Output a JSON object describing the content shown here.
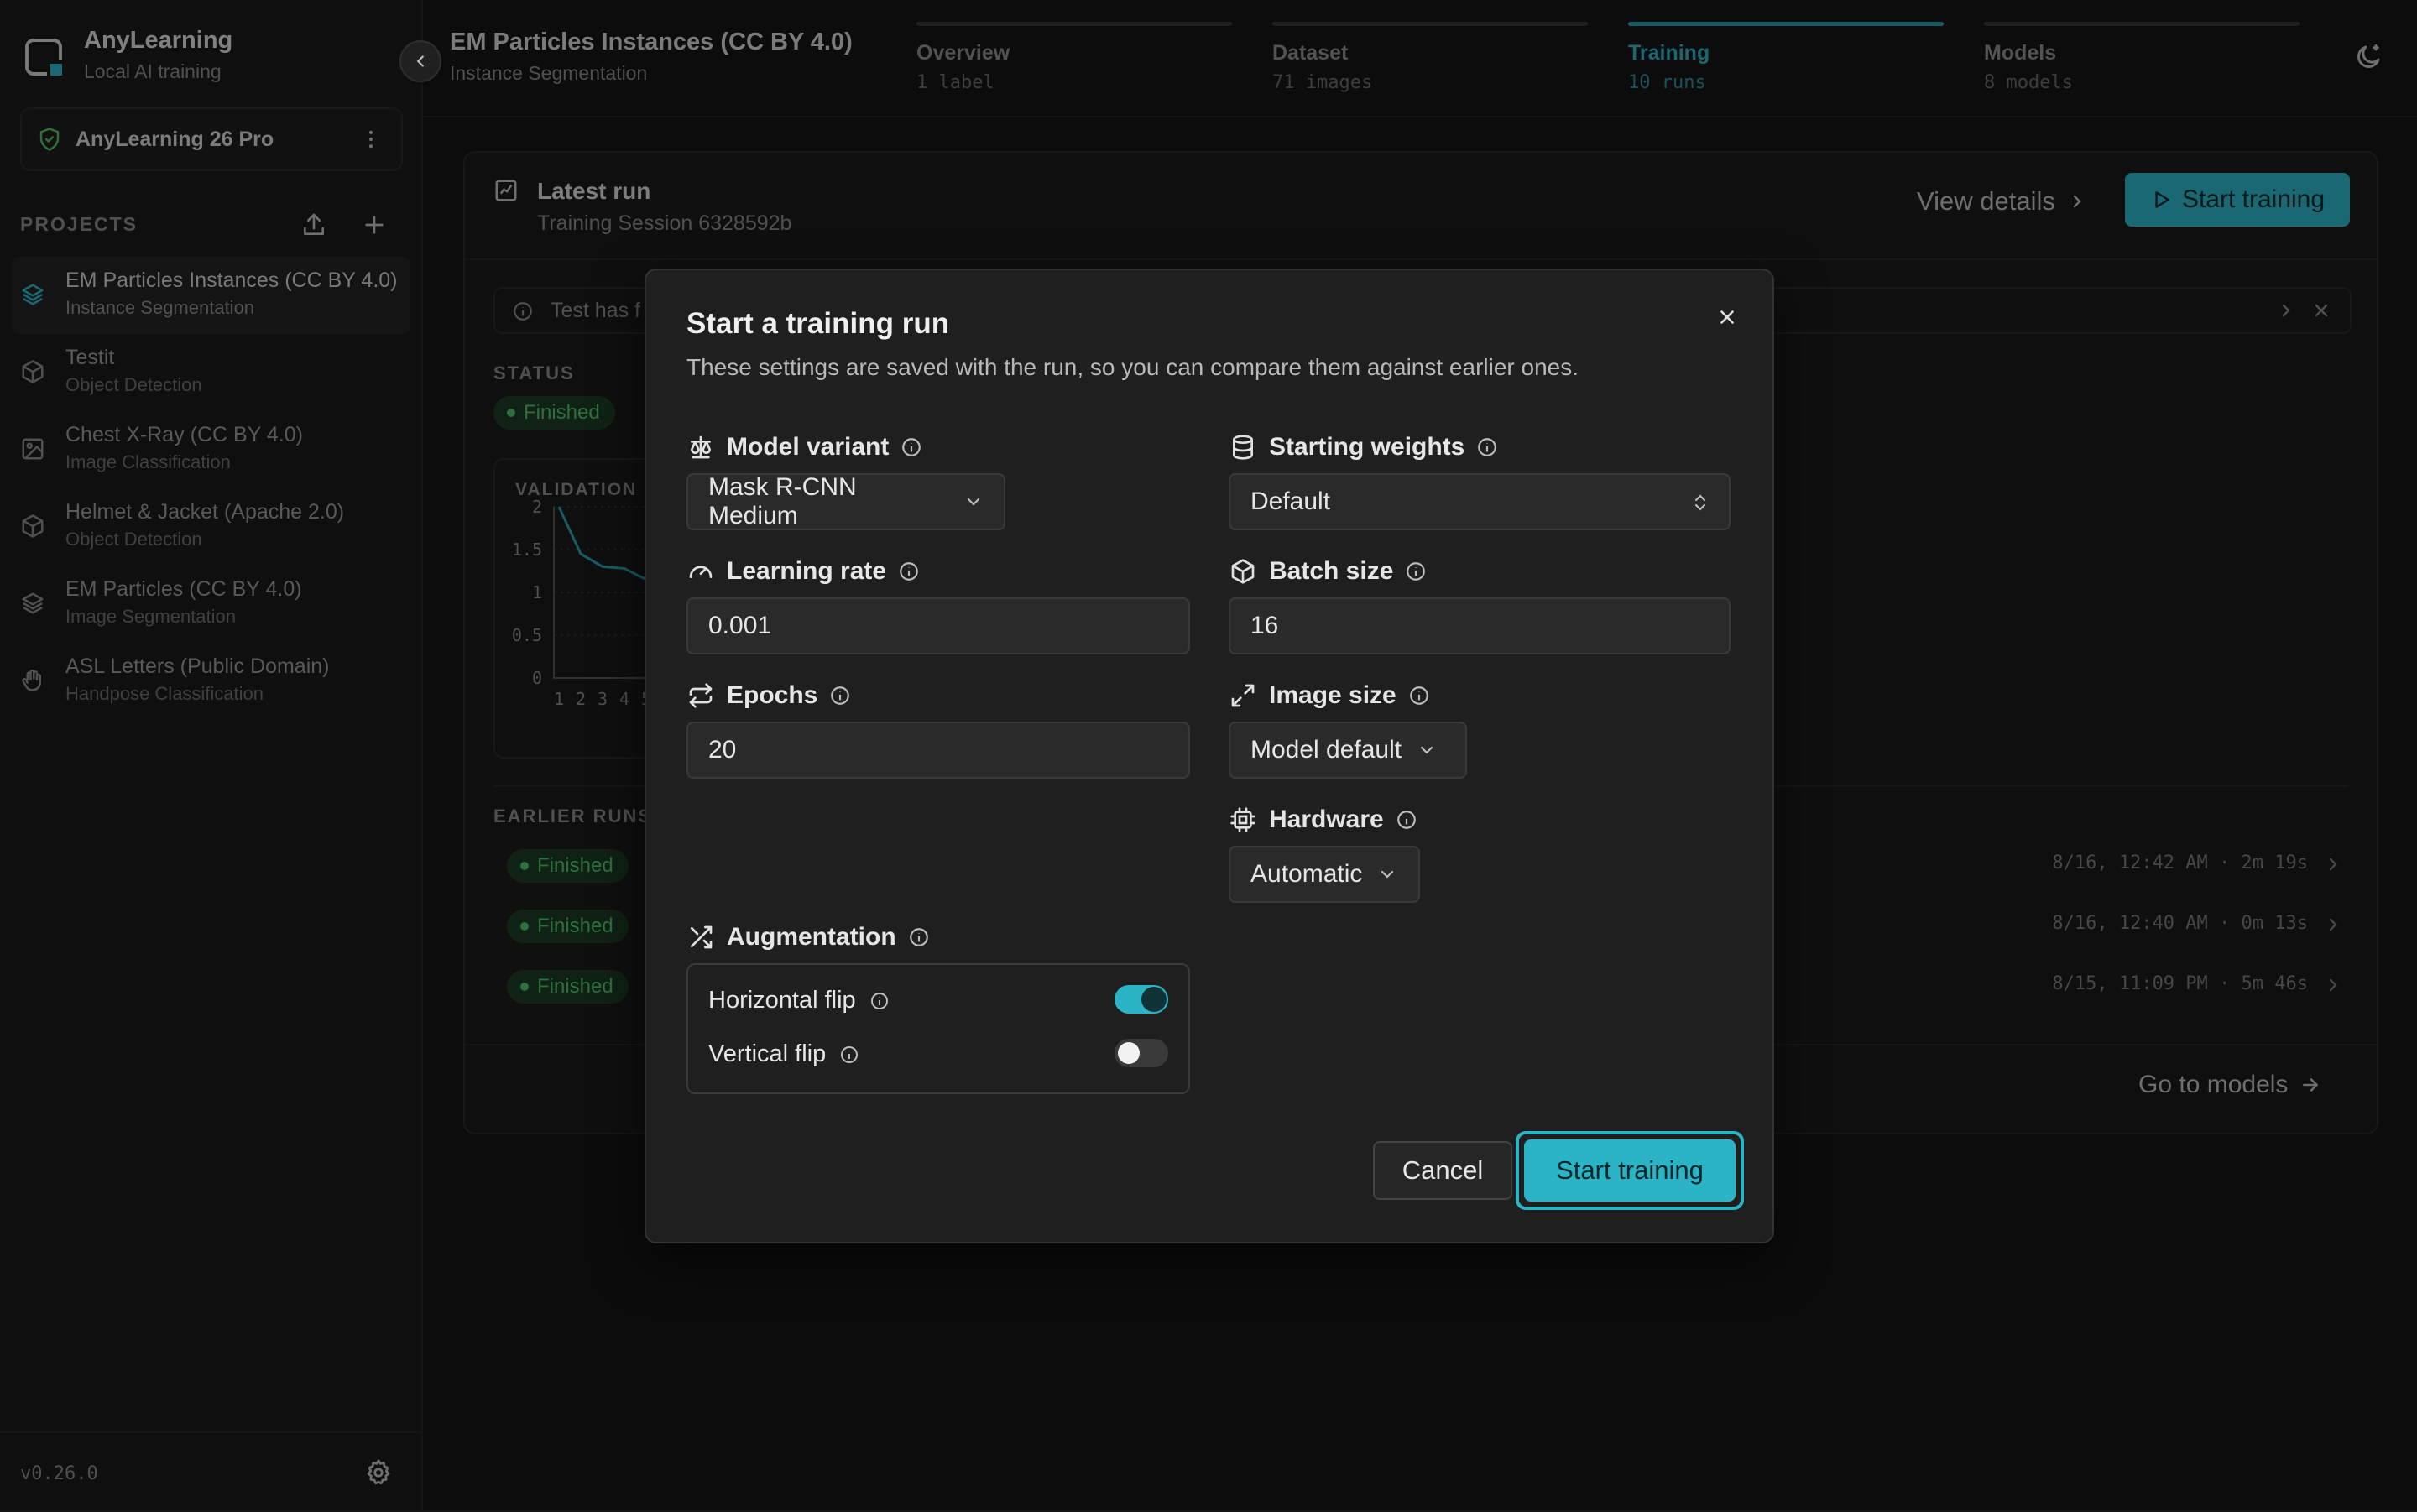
{
  "app": {
    "name": "AnyLearning",
    "subtitle": "Local AI training",
    "version": "v0.26.0"
  },
  "license": {
    "label": "AnyLearning 26 Pro"
  },
  "sidebar": {
    "projects_heading": "PROJECTS",
    "projects": [
      {
        "name": "EM Particles Instances (CC BY 4.0)",
        "type": "Instance Segmentation",
        "icon": "layers-icon",
        "active": true
      },
      {
        "name": "Testit",
        "type": "Object Detection",
        "icon": "cube-icon"
      },
      {
        "name": "Chest X-Ray (CC BY 4.0)",
        "type": "Image Classification",
        "icon": "image-icon"
      },
      {
        "name": "Helmet & Jacket (Apache 2.0)",
        "type": "Object Detection",
        "icon": "cube-icon"
      },
      {
        "name": "EM Particles (CC BY 4.0)",
        "type": "Image Segmentation",
        "icon": "layers-icon"
      },
      {
        "name": "ASL Letters (Public Domain)",
        "type": "Handpose Classification",
        "icon": "hand-icon"
      }
    ]
  },
  "header": {
    "project_title": "EM Particles Instances (CC BY 4.0)",
    "project_type": "Instance Segmentation",
    "steps": [
      {
        "label": "Overview",
        "sub": "1 label"
      },
      {
        "label": "Dataset",
        "sub": "71 images"
      },
      {
        "label": "Training",
        "sub": "10 runs",
        "active": true
      },
      {
        "label": "Models",
        "sub": "8 models"
      }
    ]
  },
  "main": {
    "latest_run_title": "Latest run",
    "latest_run_sub": "Training Session 6328592b",
    "view_details": "View details",
    "start_training": "Start training",
    "notice_text": "Test has f",
    "status_heading": "STATUS",
    "status_value": "Finished",
    "chart_title": "VALIDATION",
    "earlier_heading": "EARLIER RUNS",
    "earlier_runs": [
      {
        "status": "Finished",
        "meta": "8/16, 12:42 AM · 2m 19s"
      },
      {
        "status": "Finished",
        "meta": "8/16, 12:40 AM · 0m 13s"
      },
      {
        "status": "Finished",
        "meta": "8/15, 11:09 PM · 5m 46s"
      }
    ],
    "go_to_models": "Go to models"
  },
  "chart_data": {
    "type": "line",
    "title": "VALIDATION",
    "x": [
      1,
      2,
      3,
      4,
      5
    ],
    "y_ticks": [
      "2",
      "1.5",
      "1",
      "0.5",
      "0"
    ],
    "x_ticks": [
      "1",
      "2",
      "3",
      "4",
      "5"
    ],
    "ylim": [
      0,
      2
    ],
    "series": [
      {
        "values": [
          2.0,
          1.45,
          1.3,
          1.28,
          1.15
        ]
      }
    ],
    "grid": true
  },
  "modal": {
    "title": "Start a training run",
    "description": "These settings are saved with the run, so you can compare them against earlier ones.",
    "model_variant": {
      "label": "Model variant",
      "value": "Mask R-CNN Medium"
    },
    "starting_weights": {
      "label": "Starting weights",
      "value": "Default"
    },
    "learning_rate": {
      "label": "Learning rate",
      "value": "0.001"
    },
    "batch_size": {
      "label": "Batch size",
      "value": "16"
    },
    "epochs": {
      "label": "Epochs",
      "value": "20"
    },
    "image_size": {
      "label": "Image size",
      "value": "Model default"
    },
    "hardware": {
      "label": "Hardware",
      "value": "Automatic"
    },
    "augmentation": {
      "label": "Augmentation",
      "horizontal_flip": {
        "label": "Horizontal flip",
        "on": true
      },
      "vertical_flip": {
        "label": "Vertical flip",
        "on": false
      }
    },
    "cancel": "Cancel",
    "start": "Start training"
  },
  "colors": {
    "accent": "#2bb3c6",
    "success": "#4fc26a",
    "background": "#151515"
  }
}
